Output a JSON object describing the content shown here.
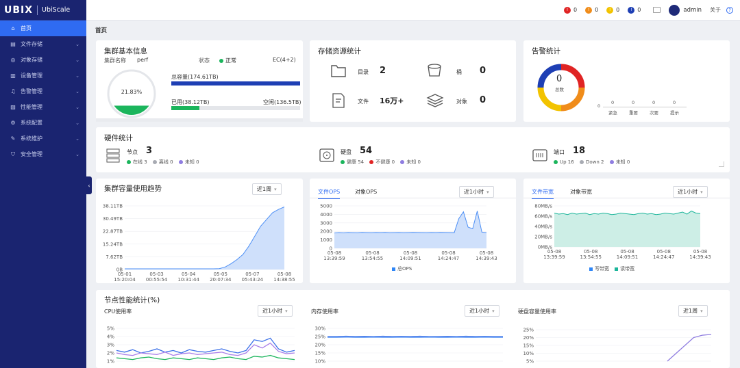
{
  "app": {
    "brand": "UBIX",
    "product": "UbiScale"
  },
  "sidebar": {
    "items": [
      {
        "label": "首页",
        "icon": "home-icon",
        "active": true
      },
      {
        "label": "文件存储",
        "icon": "file-icon"
      },
      {
        "label": "对象存储",
        "icon": "object-icon"
      },
      {
        "label": "设备管理",
        "icon": "device-icon"
      },
      {
        "label": "告警管理",
        "icon": "bell-icon"
      },
      {
        "label": "性能管理",
        "icon": "performance-icon"
      },
      {
        "label": "系统配置",
        "icon": "gear-icon"
      },
      {
        "label": "系统维护",
        "icon": "wrench-icon"
      },
      {
        "label": "安全管理",
        "icon": "shield-icon"
      }
    ]
  },
  "topbar": {
    "alerts": [
      {
        "count": "0",
        "color": "#e02424"
      },
      {
        "count": "0",
        "color": "#f08c1a"
      },
      {
        "count": "0",
        "color": "#f2c300"
      },
      {
        "count": "0",
        "color": "#1e3fb4"
      }
    ],
    "user": "admin",
    "about": "关于"
  },
  "breadcrumb": "首页",
  "cluster": {
    "title": "集群基本信息",
    "name_label": "集群名称",
    "name": "perf",
    "status_label": "状态",
    "status": "正常",
    "ec": "EC(4+2)",
    "usage_percent": "21.83%",
    "usage_fraction": 0.2183,
    "total": "总容量(174.61TB)",
    "used": "已用(38.12TB)",
    "free": "空闲(136.5TB)"
  },
  "storage": {
    "title": "存储资源统计",
    "items": [
      {
        "label": "目录",
        "value": "2",
        "icon": "folder-icon"
      },
      {
        "label": "桶",
        "value": "0",
        "icon": "bucket-icon"
      },
      {
        "label": "文件",
        "value": "16万+",
        "icon": "document-icon"
      },
      {
        "label": "对象",
        "value": "0",
        "icon": "layers-icon"
      }
    ]
  },
  "alarms": {
    "title": "告警统计",
    "total": "0",
    "total_label": "总数",
    "colors": [
      "#e02424",
      "#f08c1a",
      "#f2c300",
      "#1e3fb4"
    ],
    "bars": [
      {
        "label": "紧急",
        "value": "0"
      },
      {
        "label": "重要",
        "value": "0"
      },
      {
        "label": "次要",
        "value": "0"
      },
      {
        "label": "提示",
        "value": "0"
      }
    ],
    "axis_zero": "0"
  },
  "hardware": {
    "title": "硬件统计",
    "nodes": {
      "label": "节点",
      "value": "3",
      "states": [
        "在线 3",
        "离线 0",
        "未知 0"
      ]
    },
    "disks": {
      "label": "硬盘",
      "value": "54",
      "states": [
        "健康 54",
        "不健康 0",
        "未知 0"
      ]
    },
    "ports": {
      "label": "端口",
      "value": "18",
      "states": [
        "Up 16",
        "Down 2",
        "未知 0"
      ]
    }
  },
  "capacity_trend": {
    "title": "集群容量使用趋势",
    "range": "近1周"
  },
  "ops": {
    "tabs": [
      "文件OPS",
      "对象OPS"
    ],
    "range": "近1小时",
    "legend": "总OPS"
  },
  "bandwidth": {
    "tabs": [
      "文件带宽",
      "对象带宽"
    ],
    "range": "近1小时",
    "legend": [
      "写带宽",
      "读带宽"
    ]
  },
  "node_perf": {
    "title": "节点性能统计(%)",
    "cpu": {
      "label": "CPU使用率",
      "range": "近1小时"
    },
    "mem": {
      "label": "内存使用率",
      "range": "近1小时"
    },
    "disk": {
      "label": "硬盘容量使用率",
      "range": "近1周"
    }
  },
  "chart_data": [
    {
      "type": "area",
      "name": "capacity",
      "y_ticks": [
        "38.11TB",
        "30.49TB",
        "22.87TB",
        "15.24TB",
        "7.62TB",
        "0B"
      ],
      "ylim": [
        0,
        38.11
      ],
      "x_ticks": [
        "05-01\n15:20:04",
        "05-03\n00:55:54",
        "05-04\n10:31:44",
        "05-05\n20:07:34",
        "05-07\n05:43:24",
        "05-08\n14:38:55"
      ],
      "values": [
        0.4,
        0.4,
        0.4,
        0.4,
        0.4,
        0.4,
        0.4,
        0.4,
        0.4,
        0.4,
        0.4,
        0.4,
        0.4,
        0.4,
        0.4,
        0.4,
        0.5,
        1.5,
        3.5,
        6,
        9,
        14,
        20,
        26,
        30,
        34,
        36,
        37.5
      ]
    },
    {
      "type": "area",
      "name": "ops",
      "y_ticks": [
        "5000",
        "4000",
        "3000",
        "2000",
        "1000",
        "0"
      ],
      "ylim": [
        0,
        5000
      ],
      "x_ticks": [
        "05-08\n13:39:59",
        "05-08\n13:54:55",
        "05-08\n14:09:51",
        "05-08\n14:24:47",
        "05-08\n14:39:43"
      ],
      "series": [
        {
          "name": "总OPS",
          "values": [
            1800,
            1850,
            1820,
            1860,
            1840,
            1830,
            1870,
            1850,
            1840,
            1860,
            1850,
            1870,
            1840,
            1850,
            1860,
            1840,
            1850,
            1870,
            1860,
            1850,
            1840,
            1860,
            1850,
            1870,
            1860,
            1850,
            1840,
            3500,
            4300,
            2500,
            2300,
            4400,
            1900,
            1850
          ]
        }
      ]
    },
    {
      "type": "area",
      "name": "bandwidth",
      "y_ticks": [
        "80MB/s",
        "60MB/s",
        "40MB/s",
        "20MB/s",
        "0MB/s"
      ],
      "ylim": [
        0,
        80
      ],
      "x_ticks": [
        "05-08\n13:39:59",
        "05-08\n13:54:55",
        "05-08\n14:09:51",
        "05-08\n14:24:47",
        "05-08\n14:39:43"
      ],
      "series": [
        {
          "name": "写带宽",
          "values": [
            0,
            0,
            0,
            0,
            0
          ]
        },
        {
          "name": "读带宽",
          "values": [
            66,
            64,
            65,
            63,
            66,
            64,
            65,
            66,
            63,
            65,
            64,
            66,
            65,
            63,
            64,
            66,
            65,
            64,
            63,
            65,
            66,
            64,
            65,
            63,
            64,
            66,
            65,
            64,
            66,
            68,
            64,
            70,
            66,
            65
          ]
        }
      ]
    },
    {
      "type": "line",
      "name": "cpu",
      "y_ticks": [
        "5%",
        "4%",
        "3%",
        "2%",
        "1%"
      ],
      "ylim": [
        1,
        5
      ],
      "series": [
        {
          "values": [
            2.3,
            2.1,
            2.4,
            2.0,
            2.2,
            2.5,
            2.1,
            2.3,
            2.0,
            2.4,
            2.2,
            2.1,
            2.3,
            2.5,
            2.2,
            2.0,
            2.3,
            3.6,
            3.4,
            3.8,
            2.5,
            2.1,
            2.3
          ]
        },
        {
          "values": [
            2.0,
            1.8,
            1.7,
            2.0,
            1.9,
            1.8,
            2.1,
            1.7,
            1.9,
            2.0,
            1.8,
            1.9,
            2.0,
            2.1,
            1.8,
            1.7,
            2.0,
            3.0,
            2.6,
            3.2,
            2.2,
            1.9,
            2.0
          ]
        },
        {
          "values": [
            1.4,
            1.3,
            1.2,
            1.4,
            1.5,
            1.3,
            1.2,
            1.4,
            1.3,
            1.2,
            1.4,
            1.3,
            1.2,
            1.4,
            1.5,
            1.3,
            1.2,
            1.6,
            1.5,
            1.7,
            1.4,
            1.3,
            1.2
          ]
        }
      ]
    },
    {
      "type": "line",
      "name": "memory",
      "y_ticks": [
        "30%",
        "25%",
        "20%",
        "15%",
        "10%"
      ],
      "ylim": [
        10,
        30
      ],
      "series": [
        {
          "values": [
            25,
            25,
            25.2,
            25,
            25.1,
            25,
            25.2,
            25,
            25.1,
            25,
            25.2,
            25,
            25,
            25.1,
            25,
            25.2,
            25,
            25.1,
            25,
            25
          ]
        },
        {
          "values": [
            24.5,
            24.5,
            24.6,
            24.5,
            24.5,
            24.6,
            24.5,
            24.5,
            24.6,
            24.5,
            24.5,
            24.6,
            24.5,
            24.5,
            24.6,
            24.5,
            24.5,
            24.6,
            24.5,
            24.5
          ]
        }
      ]
    },
    {
      "type": "line",
      "name": "disk",
      "y_ticks": [
        "25%",
        "20%",
        "15%",
        "10%",
        "5%"
      ],
      "ylim": [
        5,
        25
      ],
      "values": [
        null,
        null,
        null,
        null,
        null,
        null,
        null,
        null,
        null,
        null,
        null,
        null,
        null,
        null,
        null,
        5,
        10,
        15,
        20,
        21.5,
        22
      ]
    }
  ]
}
